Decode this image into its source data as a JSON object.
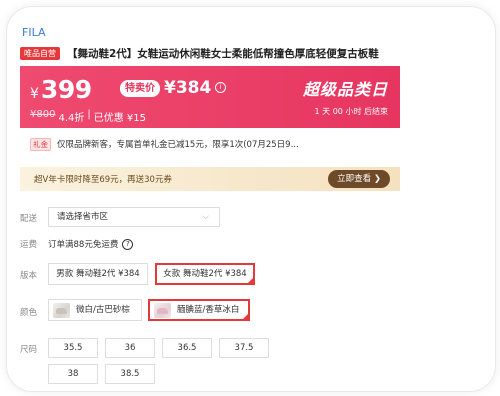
{
  "brand": "FILA",
  "badge": "唯品自营",
  "title": "【舞动鞋2代】女鞋运动休闲鞋女士柔能低帮撞色厚底轻便复古板鞋",
  "price_panel": {
    "currency": "¥",
    "price": "399",
    "special_tag": "特卖价",
    "special_price": "¥384",
    "original_price": "¥800",
    "discount": "4.4折",
    "separator": "|",
    "saved": "已优惠 ¥15",
    "promo_title": "超级品类日",
    "countdown": "1 天 00 小时 后结束",
    "info_icon": "i"
  },
  "coupon": {
    "tag": "礼金",
    "text": "仅限品牌新客，专属首单礼金已减15元，限享1次(07月25日9..."
  },
  "vip": {
    "text": "超V年卡限时降至69元，再送30元券",
    "button": "立即查看 ❯"
  },
  "shipping": {
    "label": "配送",
    "placeholder": "请选择省市区",
    "chevron": "⌵"
  },
  "freight": {
    "label": "运费",
    "text": "订单满88元免运费",
    "help_icon": "?"
  },
  "version": {
    "label": "版本",
    "options": [
      "男款 舞动鞋2代 ¥384",
      "女款 舞动鞋2代 ¥384"
    ]
  },
  "color": {
    "label": "颜色",
    "options": [
      "微白/古巴砂棕",
      "腼腆蓝/香草冰白"
    ]
  },
  "size": {
    "label": "尺码",
    "options": [
      "35.5",
      "36",
      "36.5",
      "37.5",
      "38",
      "38.5"
    ]
  },
  "colors": {
    "accent": "#e4393c",
    "panel": "#ea3e67",
    "link": "#3a7ad9",
    "vip_button": "#6e4a28"
  }
}
